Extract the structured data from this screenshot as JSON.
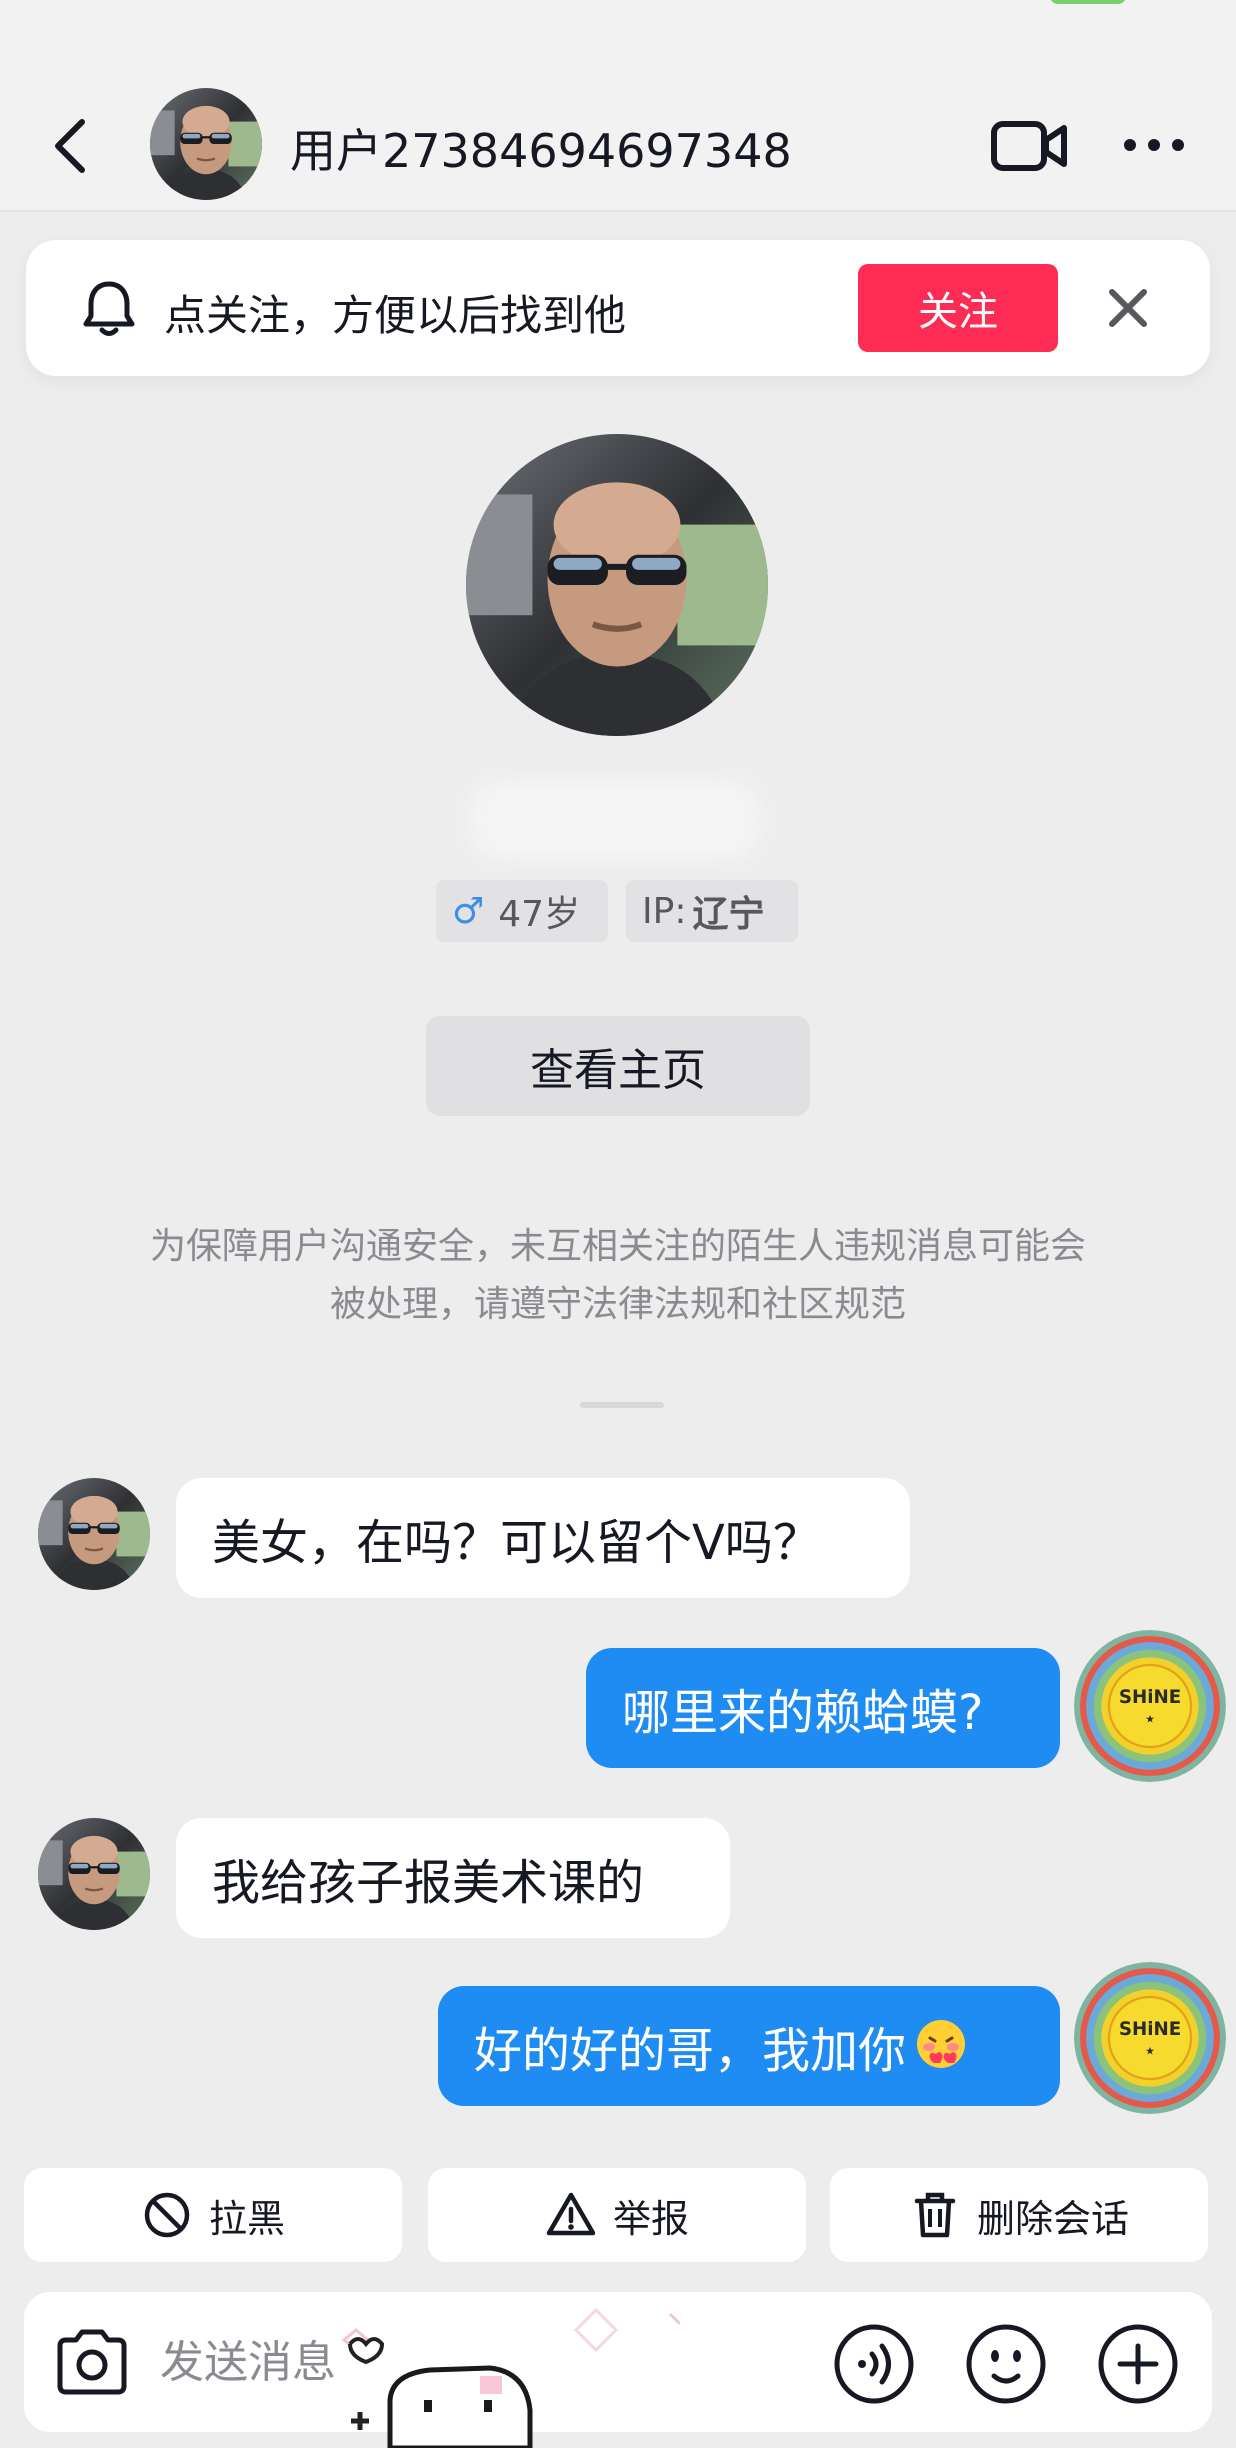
{
  "header": {
    "title": "用户27384694697348"
  },
  "follow_banner": {
    "text": "点关注，方便以后找到他",
    "follow_label": "关注"
  },
  "profile": {
    "age": "47岁",
    "ip_label": "IP:",
    "ip_value": "辽宁",
    "view_home_label": "查看主页",
    "notice": "为保障用户沟通安全，未互相关注的陌生人违规消息可能会被处理，请遵守法律法规和社区规范"
  },
  "messages": [
    {
      "from": "them",
      "text": "美女，在吗？可以留个V吗？"
    },
    {
      "from": "me",
      "text": "哪里来的赖蛤蟆?"
    },
    {
      "from": "them",
      "text": "我给孩子报美术课的"
    },
    {
      "from": "me",
      "text": "好的好的哥，我加你"
    }
  ],
  "actions": {
    "block_label": "拉黑",
    "report_label": "举报",
    "delete_label": "删除会话"
  },
  "input": {
    "placeholder": "发送消息"
  },
  "colors": {
    "follow_button": "#fe2c55",
    "outgoing_bubble": "#1f8cf3",
    "background": "#ededee"
  },
  "icons": [
    "back-icon",
    "video-call-icon",
    "more-icon",
    "bell-icon",
    "close-icon",
    "block-icon",
    "warning-icon",
    "trash-icon",
    "camera-icon",
    "voice-icon",
    "emoji-icon",
    "plus-icon"
  ]
}
